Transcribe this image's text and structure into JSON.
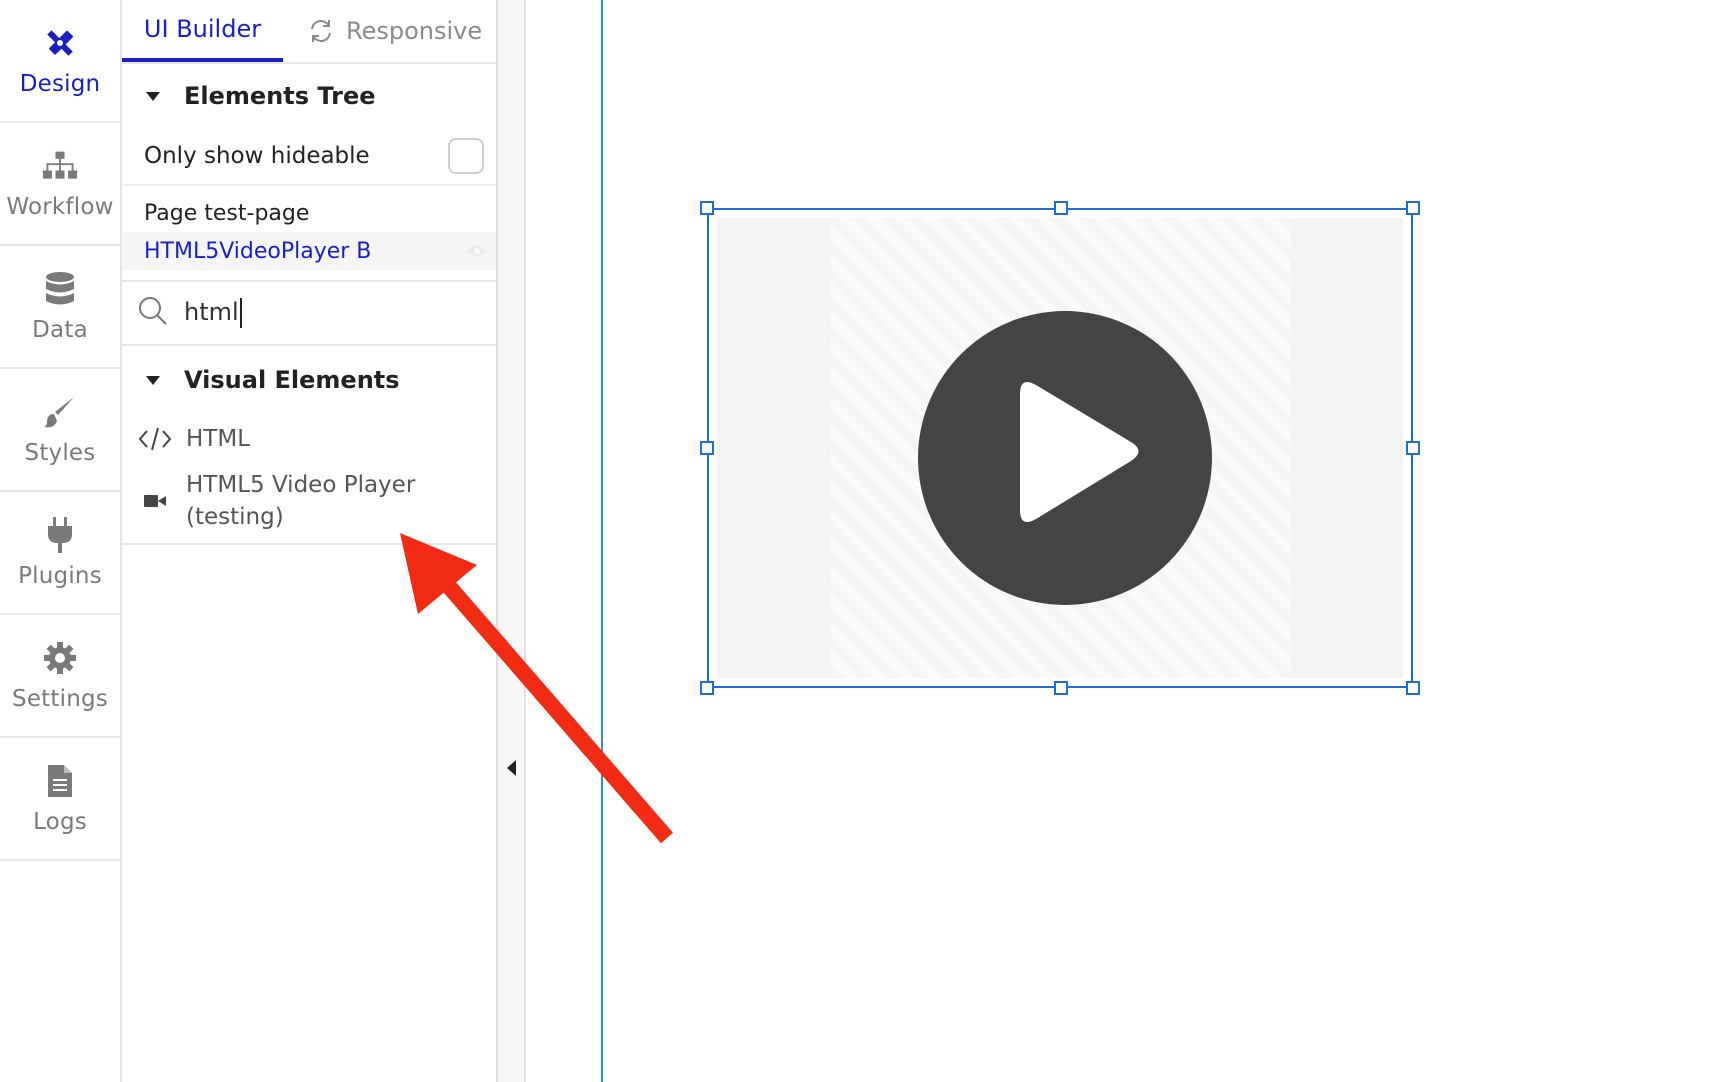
{
  "rail": {
    "items": [
      {
        "label": "Design",
        "icon": "design-pencil-ruler-icon",
        "active": true
      },
      {
        "label": "Workflow",
        "icon": "workflow-sitemap-icon"
      },
      {
        "label": "Data",
        "icon": "database-icon"
      },
      {
        "label": "Styles",
        "icon": "paintbrush-icon"
      },
      {
        "label": "Plugins",
        "icon": "plug-icon"
      },
      {
        "label": "Settings",
        "icon": "gear-icon"
      },
      {
        "label": "Logs",
        "icon": "document-icon"
      }
    ]
  },
  "tabs": {
    "ui_builder": "UI Builder",
    "responsive": "Responsive"
  },
  "elements_tree": {
    "title": "Elements Tree",
    "only_show_hideable": "Only show hideable",
    "page": "Page test-page",
    "selected_element": "HTML5VideoPlayer B"
  },
  "search": {
    "value": "html"
  },
  "visual_elements": {
    "title": "Visual Elements",
    "items": [
      {
        "label": "HTML",
        "icon": "code-brackets-icon"
      },
      {
        "label": "HTML5 Video Player",
        "label_line2": "(testing)",
        "icon": "video-camera-icon"
      }
    ]
  },
  "colors": {
    "accent": "#1a1fc4",
    "selection": "#1e6de0",
    "annotation_arrow": "#f22b14",
    "play_button": "#444444"
  }
}
